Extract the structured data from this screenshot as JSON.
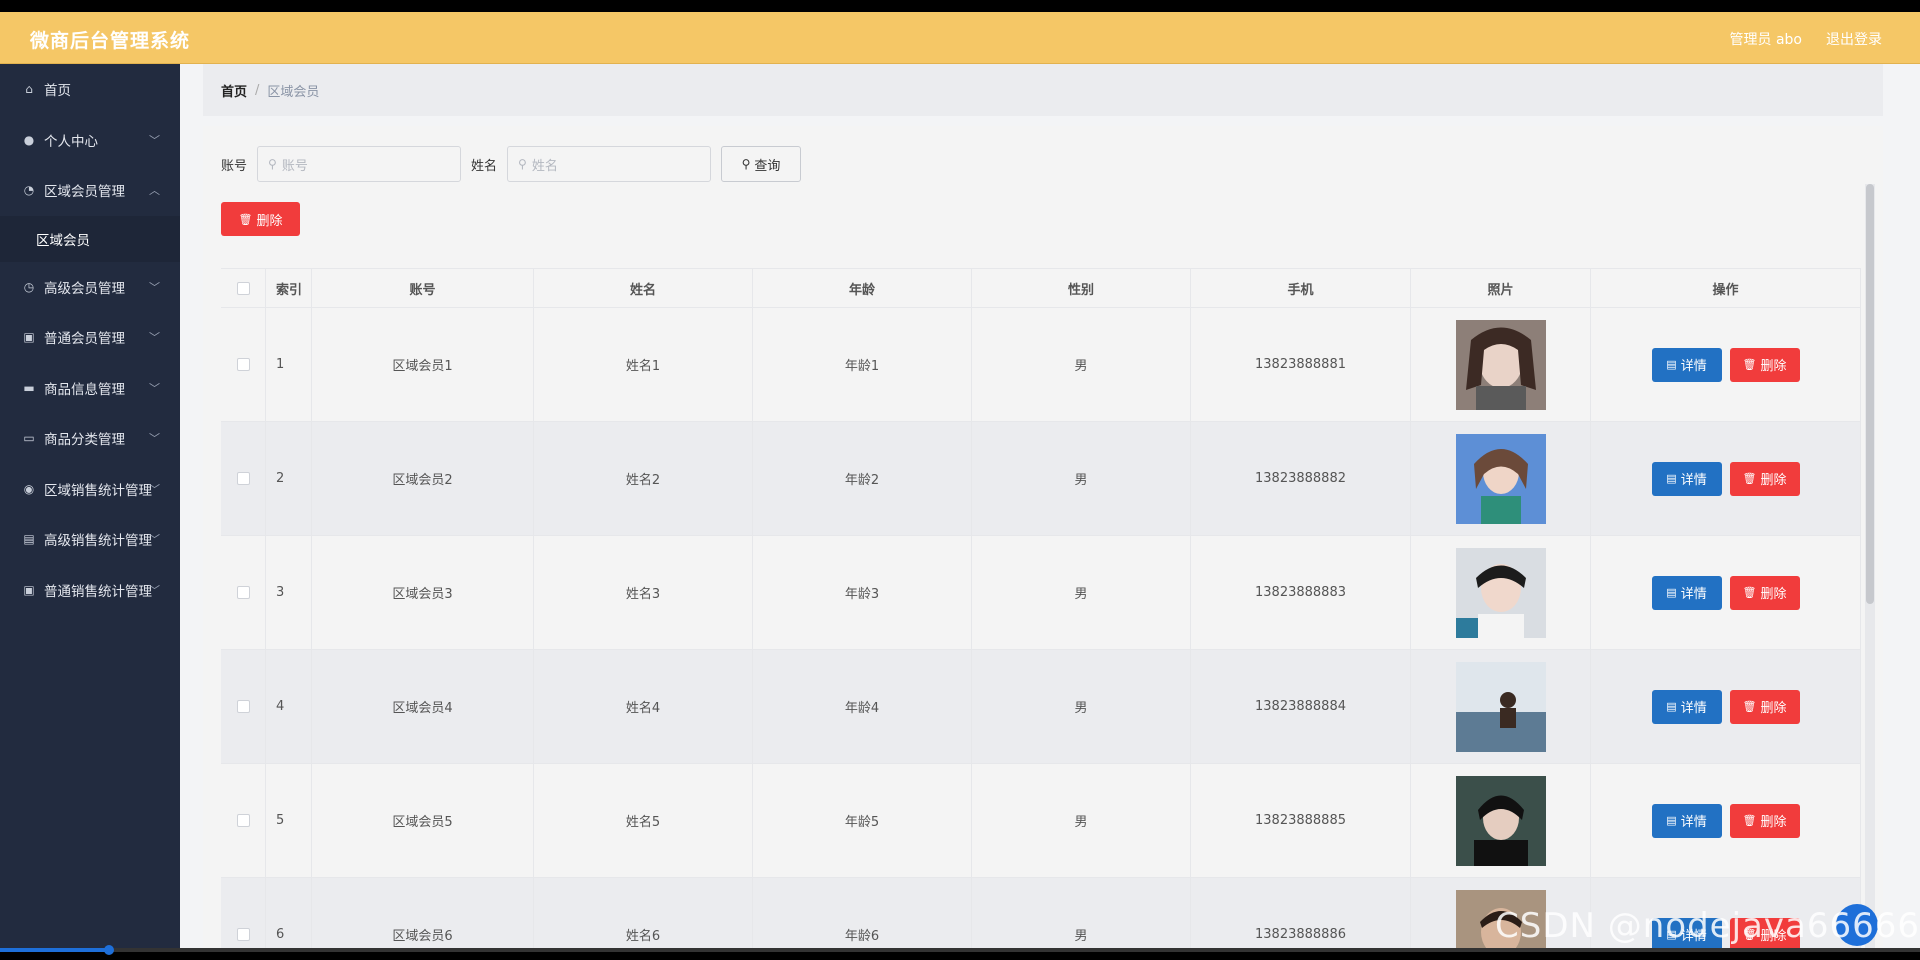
{
  "header": {
    "title": "微商后台管理系统",
    "admin": "管理员 abo",
    "logout": "退出登录"
  },
  "sidebar": {
    "items": [
      {
        "label": "首页",
        "icon": "home-icon",
        "chevron": ""
      },
      {
        "label": "个人中心",
        "icon": "user-icon",
        "chevron": "﹀"
      },
      {
        "label": "区域会员管理",
        "icon": "compass-icon",
        "chevron": "︿"
      },
      {
        "label": "区域会员",
        "sub": true
      },
      {
        "label": "高级会员管理",
        "icon": "clock-icon",
        "chevron": "﹀"
      },
      {
        "label": "普通会员管理",
        "icon": "clipboard-icon",
        "chevron": "﹀"
      },
      {
        "label": "商品信息管理",
        "icon": "chat-icon",
        "chevron": "﹀"
      },
      {
        "label": "商品分类管理",
        "icon": "message-icon",
        "chevron": "﹀"
      },
      {
        "label": "区域销售统计管理",
        "icon": "location-icon",
        "chevron": "﹀"
      },
      {
        "label": "高级销售统计管理",
        "icon": "briefcase-icon",
        "chevron": "﹀"
      },
      {
        "label": "普通销售统计管理",
        "icon": "clipboard-icon",
        "chevron": "﹀"
      }
    ]
  },
  "breadcrumb": {
    "home": "首页",
    "sep": "/",
    "current": "区域会员"
  },
  "search": {
    "account_label": "账号",
    "account_placeholder": "账号",
    "name_label": "姓名",
    "name_placeholder": "姓名",
    "query_label": "查询"
  },
  "actions": {
    "delete_label": "删除"
  },
  "table": {
    "headers": [
      "索引",
      "账号",
      "姓名",
      "年龄",
      "性别",
      "手机",
      "照片",
      "操作"
    ],
    "detail_label": "详情",
    "delete_label": "删除",
    "rows": [
      {
        "index": "1",
        "account": "区域会员1",
        "name": "姓名1",
        "age": "年龄1",
        "gender": "男",
        "phone": "13823888881"
      },
      {
        "index": "2",
        "account": "区域会员2",
        "name": "姓名2",
        "age": "年龄2",
        "gender": "男",
        "phone": "13823888882"
      },
      {
        "index": "3",
        "account": "区域会员3",
        "name": "姓名3",
        "age": "年龄3",
        "gender": "男",
        "phone": "13823888883"
      },
      {
        "index": "4",
        "account": "区域会员4",
        "name": "姓名4",
        "age": "年龄4",
        "gender": "男",
        "phone": "13823888884"
      },
      {
        "index": "5",
        "account": "区域会员5",
        "name": "姓名5",
        "age": "年龄5",
        "gender": "男",
        "phone": "13823888885"
      },
      {
        "index": "6",
        "account": "区域会员6",
        "name": "姓名6",
        "age": "年龄6",
        "gender": "男",
        "phone": "13823888886"
      }
    ]
  },
  "watermark": "CSDN @nodejava66666",
  "colors": {
    "header": "#f5c766",
    "sidebar": "#222b3f",
    "primary": "#2271c3",
    "danger": "#f13c3c"
  }
}
